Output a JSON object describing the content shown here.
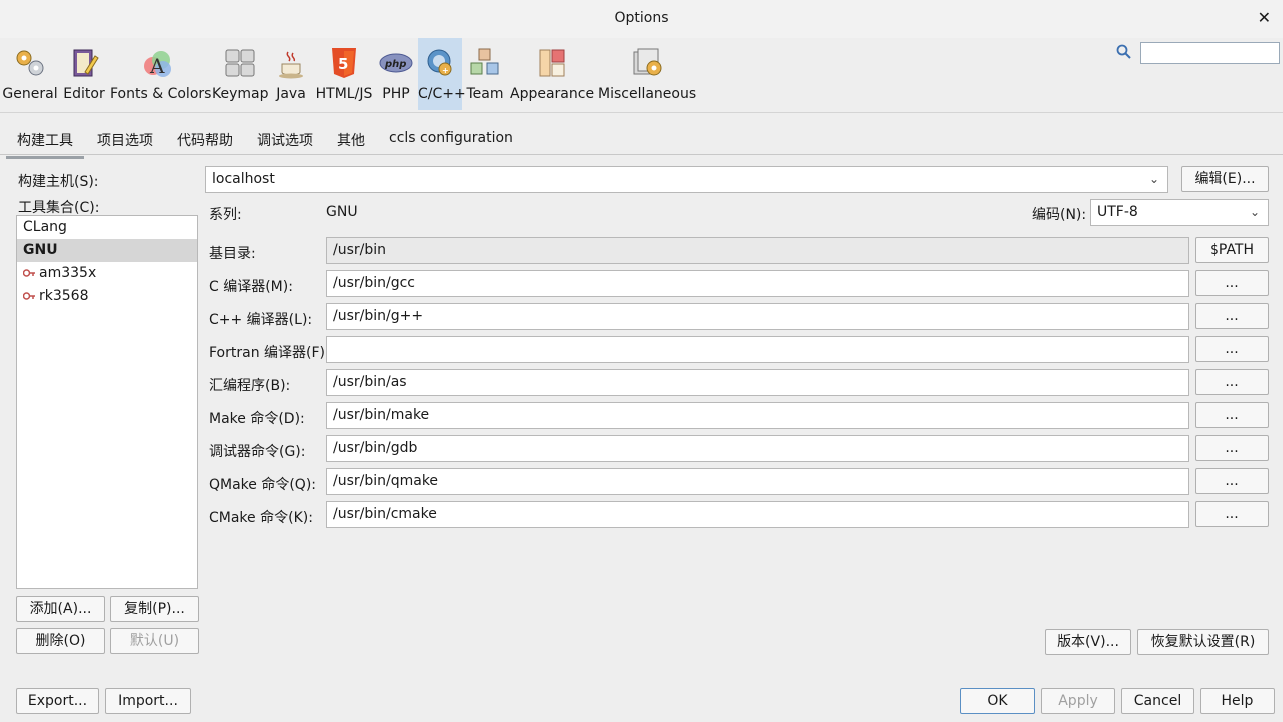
{
  "window": {
    "title": "Options"
  },
  "categories": [
    {
      "label": "General",
      "icon": "gears-icon"
    },
    {
      "label": "Editor",
      "icon": "editor-icon"
    },
    {
      "label": "Fonts & Colors",
      "icon": "fonts-colors-icon"
    },
    {
      "label": "Keymap",
      "icon": "keymap-icon"
    },
    {
      "label": "Java",
      "icon": "java-icon"
    },
    {
      "label": "HTML/JS",
      "icon": "html5-icon"
    },
    {
      "label": "PHP",
      "icon": "php-icon"
    },
    {
      "label": "C/C++",
      "icon": "cpp-icon",
      "selected": true
    },
    {
      "label": "Team",
      "icon": "team-icon"
    },
    {
      "label": "Appearance",
      "icon": "appearance-icon"
    },
    {
      "label": "Miscellaneous",
      "icon": "miscellaneous-icon"
    }
  ],
  "search": {
    "value": ""
  },
  "tabs": [
    "构建工具",
    "项目选项",
    "代码帮助",
    "调试选项",
    "其他",
    "ccls configuration"
  ],
  "left": {
    "host_label": "构建主机(S):",
    "toolset_label": "工具集合(C):",
    "toolsets": [
      {
        "label": "CLang",
        "selected": false,
        "icon": ""
      },
      {
        "label": "GNU",
        "selected": true,
        "icon": ""
      },
      {
        "label": "am335x",
        "selected": false,
        "icon": "key-icon"
      },
      {
        "label": "rk3568",
        "selected": false,
        "icon": "key-icon"
      }
    ],
    "add": "添加(A)...",
    "copy": "复制(P)...",
    "delete": "删除(O)",
    "default": "默认(U)"
  },
  "host": {
    "value": "localhost",
    "edit": "编辑(E)..."
  },
  "family": {
    "label": "系列:",
    "value": "GNU"
  },
  "encoding": {
    "label": "编码(N):",
    "value": "UTF-8"
  },
  "basedir": {
    "label": "基目录:",
    "value": "/usr/bin",
    "button": "$PATH"
  },
  "tools": [
    {
      "label": "C 编译器(M):",
      "value": "/usr/bin/gcc",
      "button": "..."
    },
    {
      "label": "C++ 编译器(L):",
      "value": "/usr/bin/g++",
      "button": "..."
    },
    {
      "label": "Fortran 编译器(F):",
      "value": "",
      "button": "..."
    },
    {
      "label": "汇编程序(B):",
      "value": "/usr/bin/as",
      "button": "..."
    },
    {
      "label": "Make 命令(D):",
      "value": "/usr/bin/make",
      "button": "..."
    },
    {
      "label": "调试器命令(G):",
      "value": "/usr/bin/gdb",
      "button": "..."
    },
    {
      "label": "QMake 命令(Q):",
      "value": "/usr/bin/qmake",
      "button": "..."
    },
    {
      "label": "CMake 命令(K):",
      "value": "/usr/bin/cmake",
      "button": "..."
    }
  ],
  "versions": "版本(V)...",
  "restore": "恢复默认设置(R)",
  "footer": {
    "export": "Export...",
    "import": "Import...",
    "ok": "OK",
    "apply": "Apply",
    "cancel": "Cancel",
    "help": "Help"
  }
}
